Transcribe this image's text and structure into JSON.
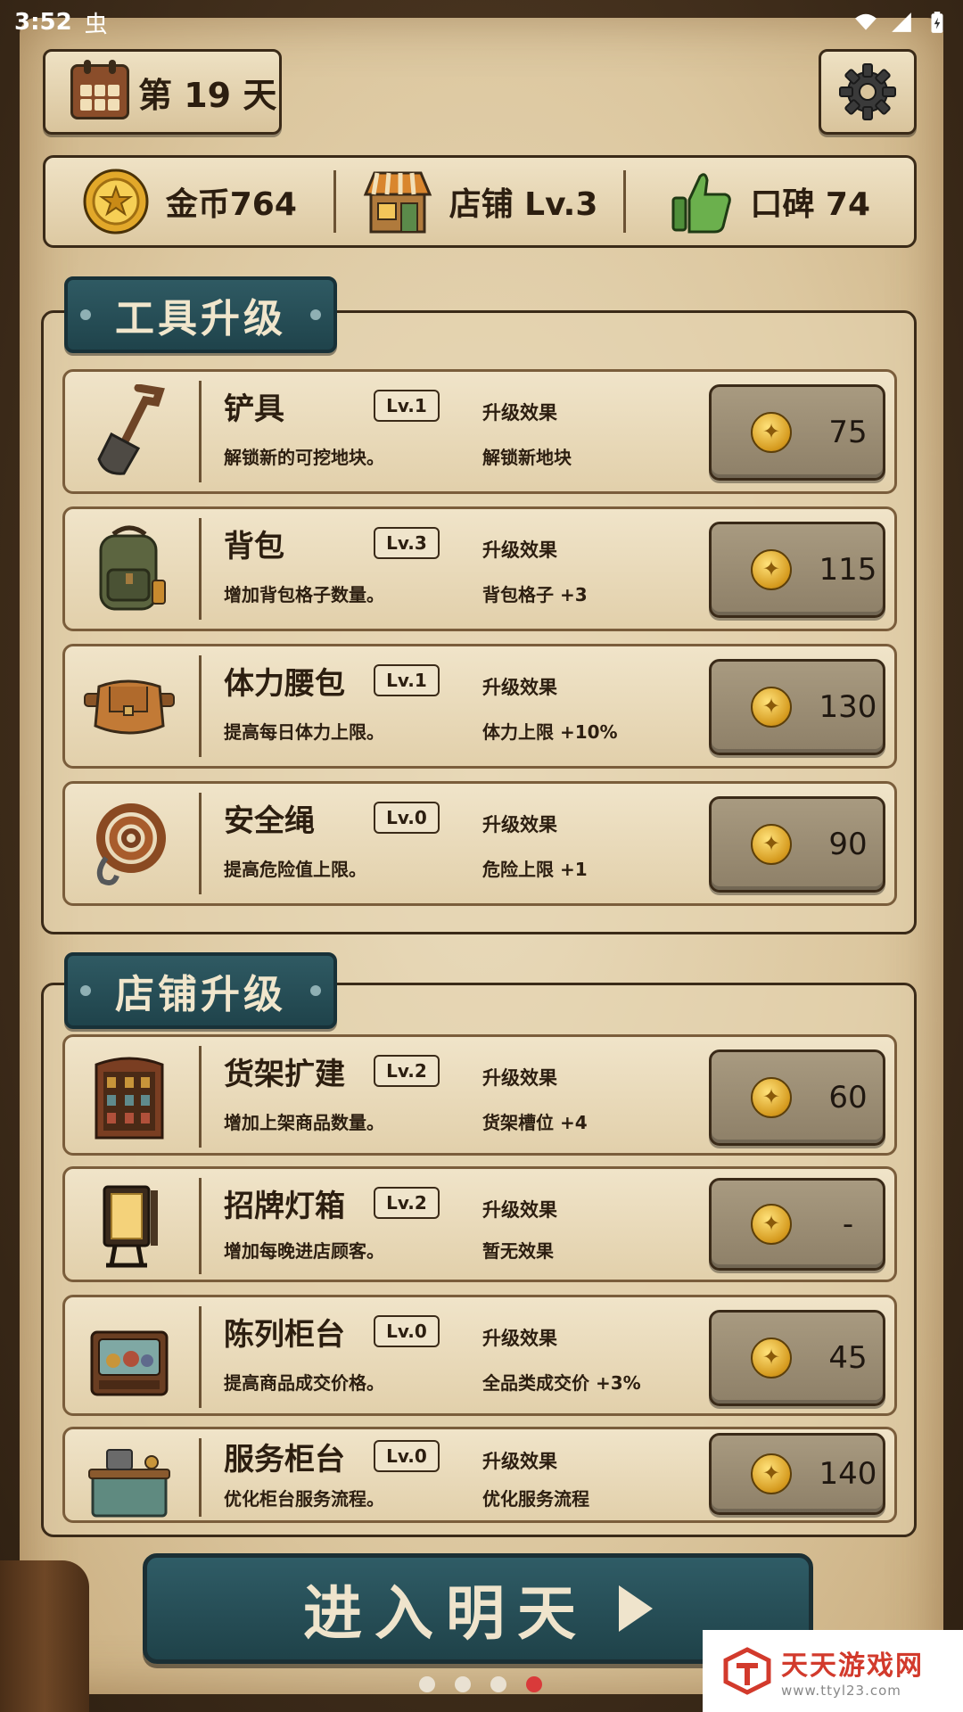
{
  "status_bar": {
    "time": "3:52",
    "bug_glyph": "虫"
  },
  "header": {
    "day_label": "第 19 天"
  },
  "resources": {
    "gold": "金币764",
    "shop": "店铺 Lv.3",
    "reputation": "口碑 74"
  },
  "tools_section": {
    "title": "工具升级",
    "items": [
      {
        "name": "铲具",
        "level": "Lv.1",
        "desc": "解锁新的可挖地块。",
        "effect_label": "升级效果",
        "effect": "解锁新地块",
        "price": "75",
        "icon": "shovel-icon"
      },
      {
        "name": "背包",
        "level": "Lv.3",
        "desc": "增加背包格子数量。",
        "effect_label": "升级效果",
        "effect": "背包格子 +3",
        "price": "115",
        "icon": "backpack-icon"
      },
      {
        "name": "体力腰包",
        "level": "Lv.1",
        "desc": "提高每日体力上限。",
        "effect_label": "升级效果",
        "effect": "体力上限 +10%",
        "price": "130",
        "icon": "waist-pouch-icon"
      },
      {
        "name": "安全绳",
        "level": "Lv.0",
        "desc": "提高危险值上限。",
        "effect_label": "升级效果",
        "effect": "危险上限 +1",
        "price": "90",
        "icon": "rope-icon"
      }
    ]
  },
  "shop_section": {
    "title": "店铺升级",
    "items": [
      {
        "name": "货架扩建",
        "level": "Lv.2",
        "desc": "增加上架商品数量。",
        "effect_label": "升级效果",
        "effect": "货架槽位 +4",
        "price": "60",
        "icon": "shelf-icon"
      },
      {
        "name": "招牌灯箱",
        "level": "Lv.2",
        "desc": "增加每晚进店顾客。",
        "effect_label": "升级效果",
        "effect": "暂无效果",
        "price": "-",
        "icon": "lightbox-sign-icon"
      },
      {
        "name": "陈列柜台",
        "level": "Lv.0",
        "desc": "提高商品成交价格。",
        "effect_label": "升级效果",
        "effect": "全品类成交价 +3%",
        "price": "45",
        "icon": "display-cabinet-icon"
      },
      {
        "name": "服务柜台",
        "level": "Lv.0",
        "desc": "优化柜台服务流程。",
        "effect_label": "升级效果",
        "effect": "优化服务流程",
        "price": "140",
        "icon": "service-counter-icon"
      }
    ]
  },
  "next_day_button": {
    "label": "进入明天"
  },
  "page_indicator": {
    "total": 4,
    "active_index": 3
  },
  "watermark": {
    "name": "天天游戏网",
    "url": "www.ttyl23.com"
  },
  "colors": {
    "teal": "#1f434b",
    "parchment": "#eadcbd",
    "ink": "#2c1e10",
    "active_dot": "#d93a3a"
  }
}
